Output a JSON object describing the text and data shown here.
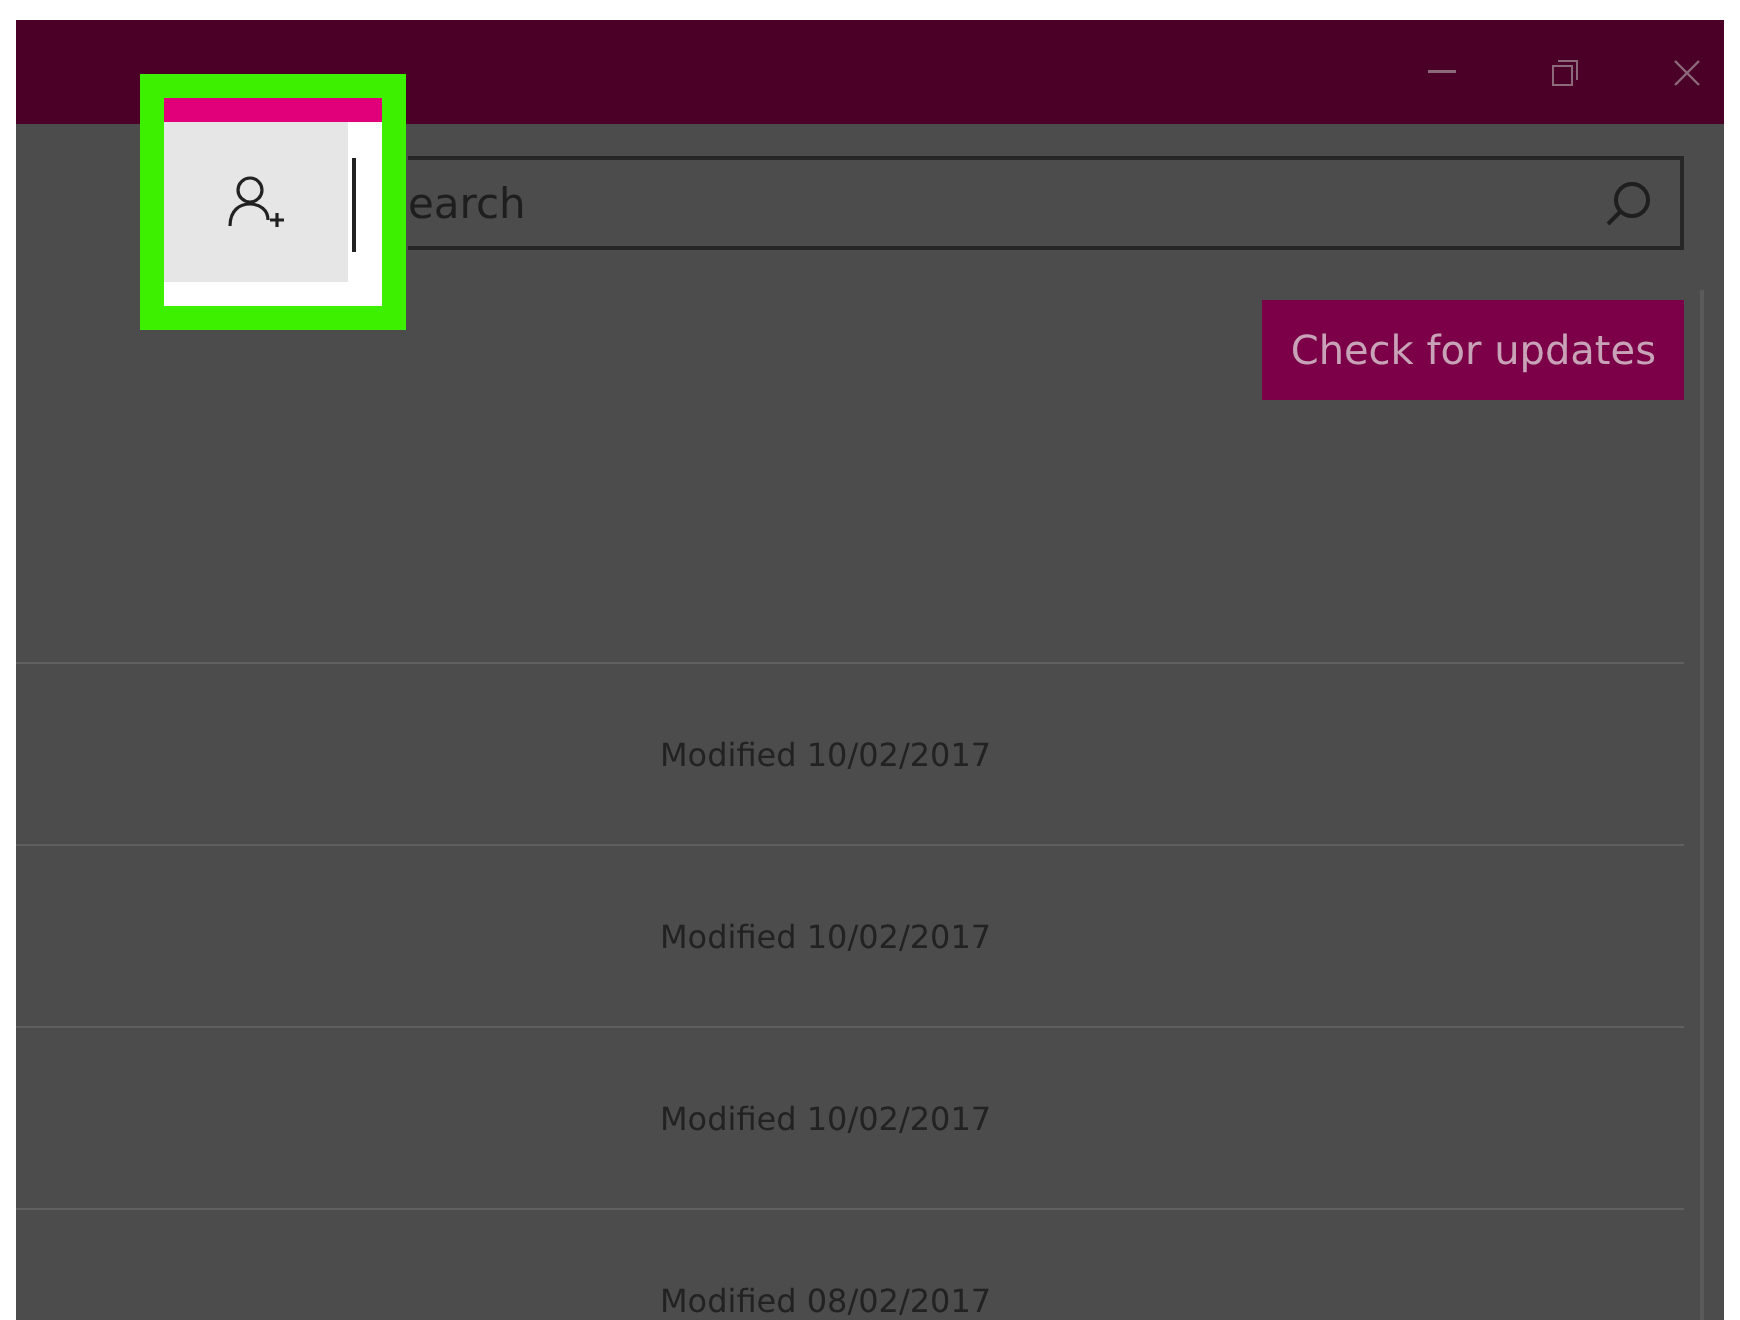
{
  "toolbar": {
    "add_user_button": {
      "highlighted": true
    },
    "search": {
      "placeholder": "earch"
    }
  },
  "check_updates_button": {
    "label": "Check for updates"
  },
  "rows": [
    {
      "modified": "Modified 10/02/2017"
    },
    {
      "modified": "Modified 10/02/2017"
    },
    {
      "modified": "Modified 10/02/2017"
    },
    {
      "modified": "Modified 08/02/2017"
    }
  ]
}
